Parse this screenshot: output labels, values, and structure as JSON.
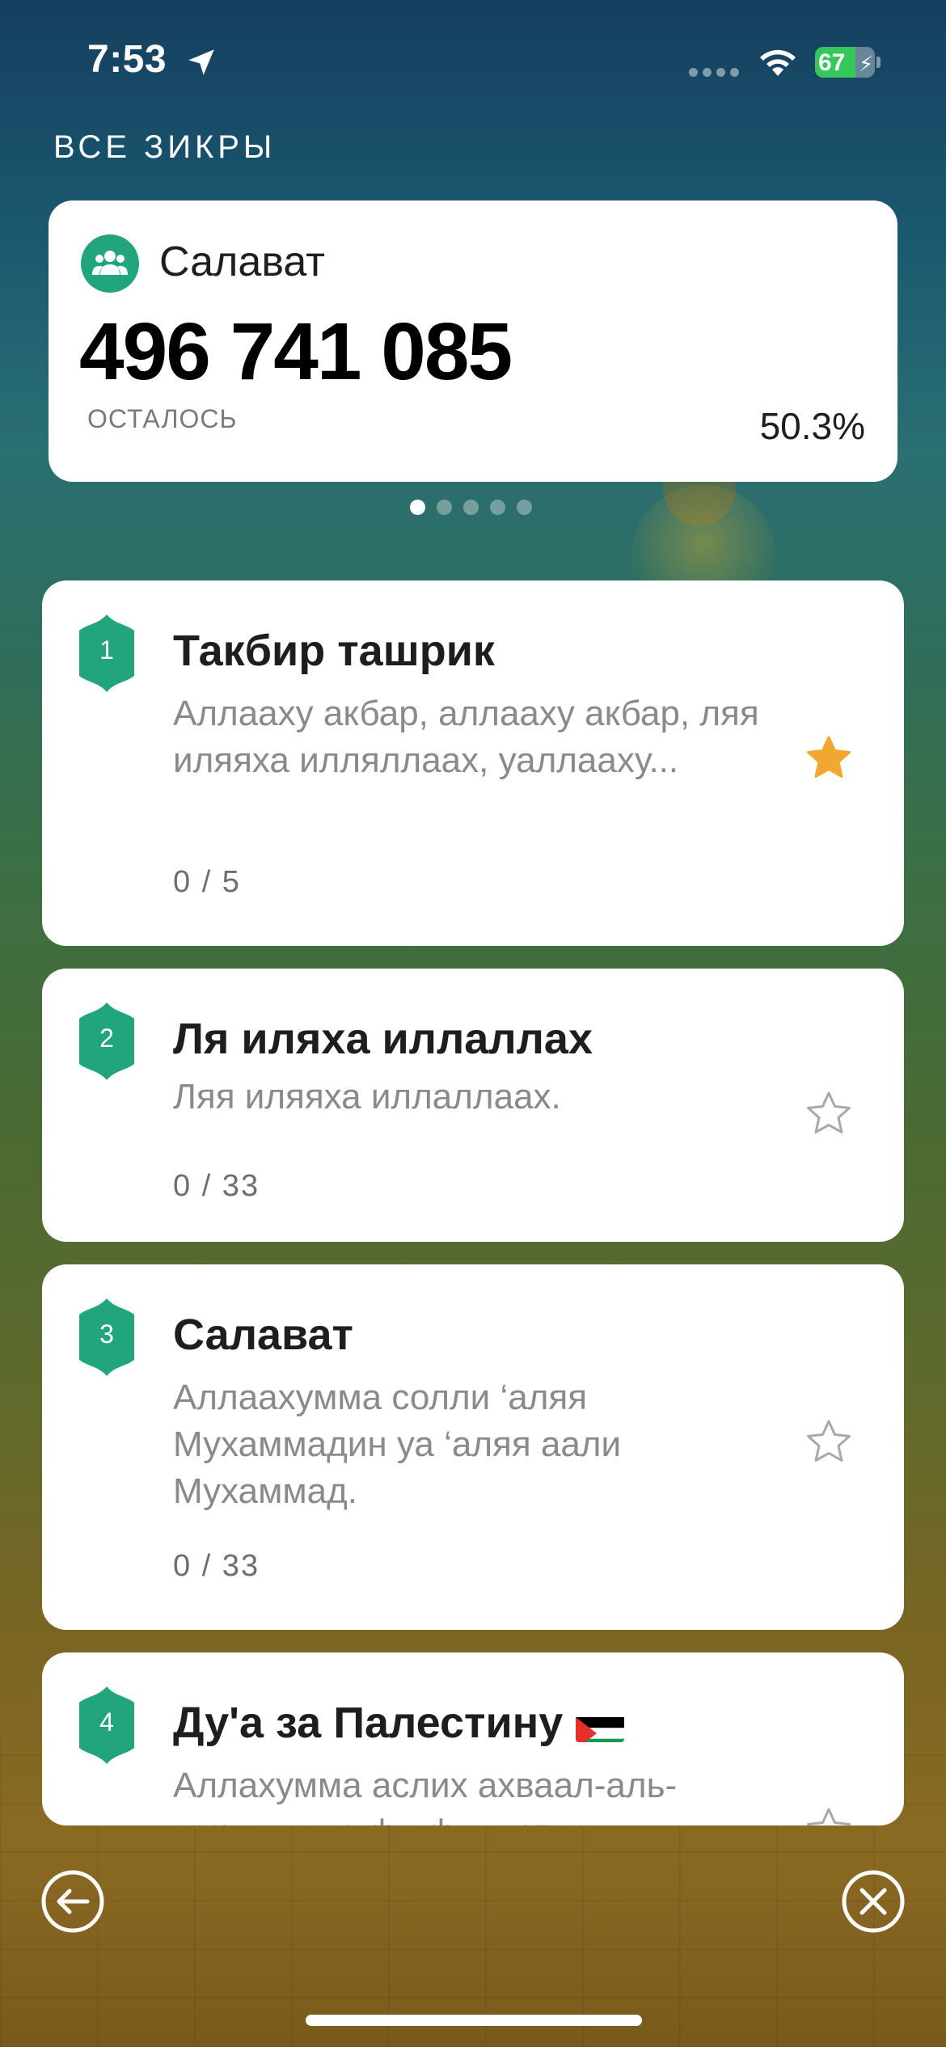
{
  "status_bar": {
    "time": "7:53",
    "battery": "67",
    "battery_level": 0.67
  },
  "section_title": "ВСЕ ЗИКРЫ",
  "summary": {
    "name": "Салават",
    "number": "496 741 085",
    "remaining_label": "ОСТАЛОСЬ",
    "percent": "50.3%",
    "pages": 5,
    "active_page": 0
  },
  "zikrs": [
    {
      "num": "1",
      "title": "Такбир ташрик",
      "text": "Аллааху акбар, аллааху акбар, ляя иляяха илляллаах, уаллааху...",
      "count": "0 / 5",
      "favorite": true
    },
    {
      "num": "2",
      "title": "Ля иляха иллаллах",
      "text": "Ляя иляяха иллаллаах.",
      "count": "0 / 33",
      "favorite": false
    },
    {
      "num": "3",
      "title": "Салават",
      "text": "Аллаахумма солли ‘аляя Мухаммадин уа ‘аляя аали Мухаммад.",
      "count": "0 / 33",
      "favorite": false
    },
    {
      "num": "4",
      "title": "Ду'а за Палестину",
      "text": "Аллахумма аслих ахваал-аль-муслимина фи филистын",
      "count": "",
      "favorite": false
    }
  ],
  "icons": {
    "location": "location-arrow-icon",
    "wifi": "wifi-icon",
    "group": "group-icon",
    "star_filled": "star-filled-icon",
    "star_outline": "star-outline-icon",
    "back": "back-arrow-icon",
    "close": "close-icon"
  },
  "colors": {
    "accent": "#22a47c",
    "star": "#f0a830",
    "battery": "#35c759"
  }
}
